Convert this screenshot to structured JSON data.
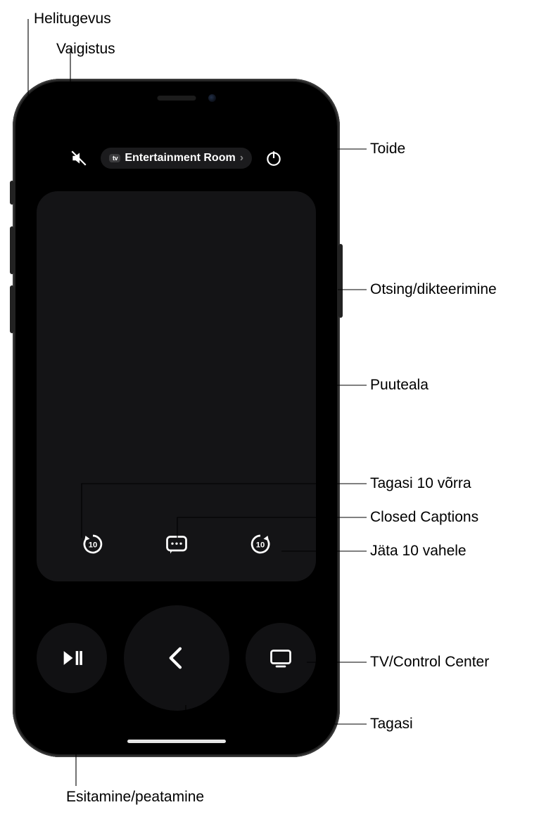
{
  "topbar": {
    "room_label": "Entertainment Room",
    "atv_badge": "tv"
  },
  "labels": {
    "volume": "Helitugevus",
    "mute": "Vaigistus",
    "power": "Toide",
    "search_dictation": "Otsing/dikteerimine",
    "touch_area": "Puuteala",
    "skip_back_10": "Tagasi 10 võrra",
    "closed_captions": "Closed Captions",
    "skip_forward_10": "Jäta 10 vahele",
    "tv_control_center": "TV/Control Center",
    "back": "Tagasi",
    "play_pause": "Esitamine/peatamine"
  },
  "icons": {
    "mute": "mute-icon",
    "power": "power-icon",
    "skip_back": "skip-back-10-icon",
    "captions": "captions-icon",
    "skip_fwd": "skip-forward-10-icon",
    "play_pause": "play-pause-icon",
    "back": "chevron-left-icon",
    "tv": "tv-icon"
  }
}
